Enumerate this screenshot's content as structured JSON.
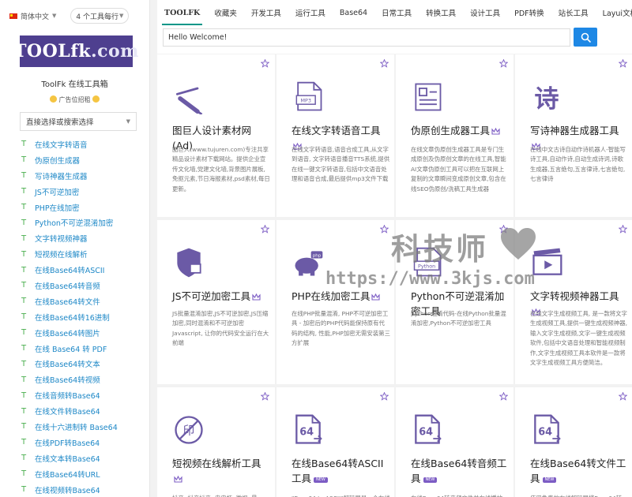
{
  "sidebar": {
    "language": "简体中文",
    "per_row": "4 个工具每行",
    "logo_text": "TOOLfk",
    "logo_suffix": ".com",
    "site_name": "ToolFk 在线工具箱",
    "ad_slot": "广告位招租",
    "search_placeholder": "直接选择或搜索选择",
    "items": [
      "在线文字转语音",
      "伪原创生成器",
      "写诗神器生成器",
      "JS不可逆加密",
      "PHP在线加密",
      "Python不可逆混淆加密",
      "文字转视频神器",
      "短视频在线解析",
      "在线Base64转ASCII",
      "在线Base64转音频",
      "在线Base64转文件",
      "在线Base64转16进制",
      "在线Base64转图片",
      "在线 Base64 转 PDF",
      "在线Base64转文本",
      "在线Base64转视频",
      "在线音频转Base64",
      "在线文件转Base64",
      "在线十六进制转 Base64",
      "在线PDF转Base64",
      "在线文本转Base64",
      "在线Base64转URL",
      "在线视频转Base64"
    ]
  },
  "nav": {
    "items": [
      "TOOLFK",
      "收藏夹",
      "开发工具",
      "运行工具",
      "Base64",
      "日常工具",
      "转换工具",
      "设计工具",
      "PDF转换",
      "站长工具",
      "Layui文档"
    ]
  },
  "search": {
    "value": "Hello Welcome!"
  },
  "cards": [
    {
      "title": "图巨人设计素材网(Ad)",
      "desc": "图巨人(www.tujuren.com)专注共享精品设计素材下载网站。提供企业宣传文化墙,党建文化墙,背景图片展板,免抠元素,节日海报素材,psd素材,每日更新。",
      "icon": "pen-icon"
    },
    {
      "title": "在线文字转语音工具",
      "desc": "在线文字转语音,语音合成工具,从文字到语音, 文字转语音播音TTS系统,提供在线一键文字转语音,包括中文语音处理和语音合成,最后提供mp3文件下载",
      "icon": "audio-file-icon"
    },
    {
      "title": "伪原创生成器工具",
      "desc": "在线文章伪原创生成器工具是专门生成原创及伪原创文章的在线工具,智能AI文章伪原创工具可以把在互联网上复制的文章瞬间变成原创文章,包含在线SEO伪原创/洗稿工具生成器",
      "icon": "document-icon"
    },
    {
      "title": "写诗神器生成器工具",
      "desc": "在线中文古诗自动作诗机器人-智能写诗工具,自动作诗,自动生成诗词,诗歌生成器,五言绝句,五言律诗,七言绝句,七言律诗",
      "icon": "poem-character-icon"
    },
    {
      "title": "JS不可逆加密工具",
      "desc": "JS批量混淆加密,JS不可逆加密,JS压缩加密,同时混淆和不可逆加密Javascript, 让你的代码安全运行在大前端",
      "icon": "shield-lock-icon"
    },
    {
      "title": "PHP在线加密工具",
      "desc": "在线PHP批量混淆, PHP不可逆加密工具 - 加密后的PHP代码能保持原有代码的结构, 性能,PHP加密无需安装第三方扩展",
      "icon": "php-elephant-icon"
    },
    {
      "title": "Python不可逆混淆加密工具",
      "desc": "python混淆代码-在线Python批量混淆加密,Python不可逆加密工具",
      "icon": "python-file-icon"
    },
    {
      "title": "文字转视频神器工具",
      "desc": "在线文字生成视频工具, 是一款将文字生成视频工具,提供一键生成视频神器,输入文字生成视频,文字一键生成视频软件,包括中文语音处理和智能视频制作,文字生成视频工具本软件是一款将文字生成视频工具方便简洁。",
      "icon": "video-clapper-icon"
    },
    {
      "title": "短视频在线解析工具",
      "desc": "抖音, 抖音抖音, 皮皮虾, 微视, 最",
      "icon": "no-watermark-icon"
    },
    {
      "title": "在线Base64转ASCII工具",
      "desc": "\"Base64 to ASCII\"解码器是一个在线",
      "icon": "base64-file-icon"
    },
    {
      "title": "在线Base64转音频工具",
      "desc": "在线Base64转音频文件并在线播放",
      "icon": "base64-file-icon"
    },
    {
      "title": "在线Base64转文件工具",
      "desc": "使用免费的在线解码器将Base64转",
      "icon": "base64-file-icon"
    }
  ],
  "watermark": {
    "text": "科技师",
    "url": "https://www.3kjs.com"
  },
  "colors": {
    "accent": "#009688",
    "icon": "#6b5aa6",
    "link": "#1e88c7",
    "search_button": "#1e88e5"
  }
}
